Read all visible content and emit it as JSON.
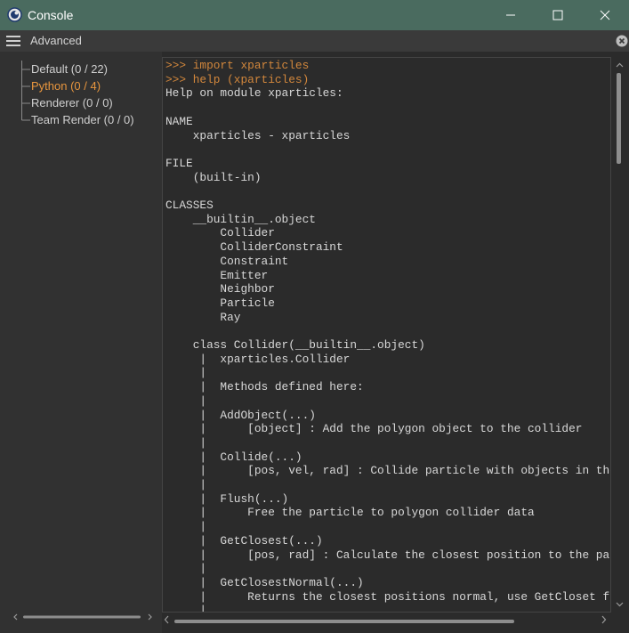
{
  "window": {
    "title": "Console",
    "icon": "cinema4d-logo-icon"
  },
  "menubar": {
    "label": "Advanced"
  },
  "sidebar": {
    "items": [
      {
        "label": "Default (0 / 22)",
        "active": false
      },
      {
        "label": "Python (0 / 4)",
        "active": true
      },
      {
        "label": "Renderer (0 / 0)",
        "active": false
      },
      {
        "label": "Team Render  (0 / 0)",
        "active": false
      }
    ]
  },
  "console": {
    "lines": [
      {
        "text": ">>> import xparticles",
        "kind": "prompt"
      },
      {
        "text": ">>> help (xparticles)",
        "kind": "prompt"
      },
      {
        "text": "Help on module xparticles:",
        "kind": "output"
      },
      {
        "text": "",
        "kind": "output"
      },
      {
        "text": "NAME",
        "kind": "output"
      },
      {
        "text": "    xparticles - xparticles",
        "kind": "output"
      },
      {
        "text": "",
        "kind": "output"
      },
      {
        "text": "FILE",
        "kind": "output"
      },
      {
        "text": "    (built-in)",
        "kind": "output"
      },
      {
        "text": "",
        "kind": "output"
      },
      {
        "text": "CLASSES",
        "kind": "output"
      },
      {
        "text": "    __builtin__.object",
        "kind": "output"
      },
      {
        "text": "        Collider",
        "kind": "output"
      },
      {
        "text": "        ColliderConstraint",
        "kind": "output"
      },
      {
        "text": "        Constraint",
        "kind": "output"
      },
      {
        "text": "        Emitter",
        "kind": "output"
      },
      {
        "text": "        Neighbor",
        "kind": "output"
      },
      {
        "text": "        Particle",
        "kind": "output"
      },
      {
        "text": "        Ray",
        "kind": "output"
      },
      {
        "text": "",
        "kind": "output"
      },
      {
        "text": "    class Collider(__builtin__.object)",
        "kind": "output"
      },
      {
        "text": "     |  xparticles.Collider",
        "kind": "output"
      },
      {
        "text": "     |",
        "kind": "output"
      },
      {
        "text": "     |  Methods defined here:",
        "kind": "output"
      },
      {
        "text": "     |",
        "kind": "output"
      },
      {
        "text": "     |  AddObject(...)",
        "kind": "output"
      },
      {
        "text": "     |      [object] : Add the polygon object to the collider",
        "kind": "output"
      },
      {
        "text": "     |",
        "kind": "output"
      },
      {
        "text": "     |  Collide(...)",
        "kind": "output"
      },
      {
        "text": "     |      [pos, vel, rad] : Collide particle with objects in the",
        "kind": "output"
      },
      {
        "text": "     |",
        "kind": "output"
      },
      {
        "text": "     |  Flush(...)",
        "kind": "output"
      },
      {
        "text": "     |      Free the particle to polygon collider data",
        "kind": "output"
      },
      {
        "text": "     |",
        "kind": "output"
      },
      {
        "text": "     |  GetClosest(...)",
        "kind": "output"
      },
      {
        "text": "     |      [pos, rad] : Calculate the closest position to the par",
        "kind": "output"
      },
      {
        "text": "     |",
        "kind": "output"
      },
      {
        "text": "     |  GetClosestNormal(...)",
        "kind": "output"
      },
      {
        "text": "     |      Returns the closest positions normal, use GetCloset fi",
        "kind": "output"
      },
      {
        "text": "     |",
        "kind": "output"
      }
    ]
  },
  "colors": {
    "titlebar": "#4a6b5f",
    "background": "#2b2b2b",
    "sidebar": "#313131",
    "prompt_text": "#d2873c",
    "active_item": "#e8963e",
    "output_text": "#d8d8d8"
  },
  "icons": [
    "cinema4d-logo-icon",
    "minimize-icon",
    "maximize-icon",
    "close-icon",
    "hamburger-menu-icon",
    "clear-close-icon"
  ]
}
